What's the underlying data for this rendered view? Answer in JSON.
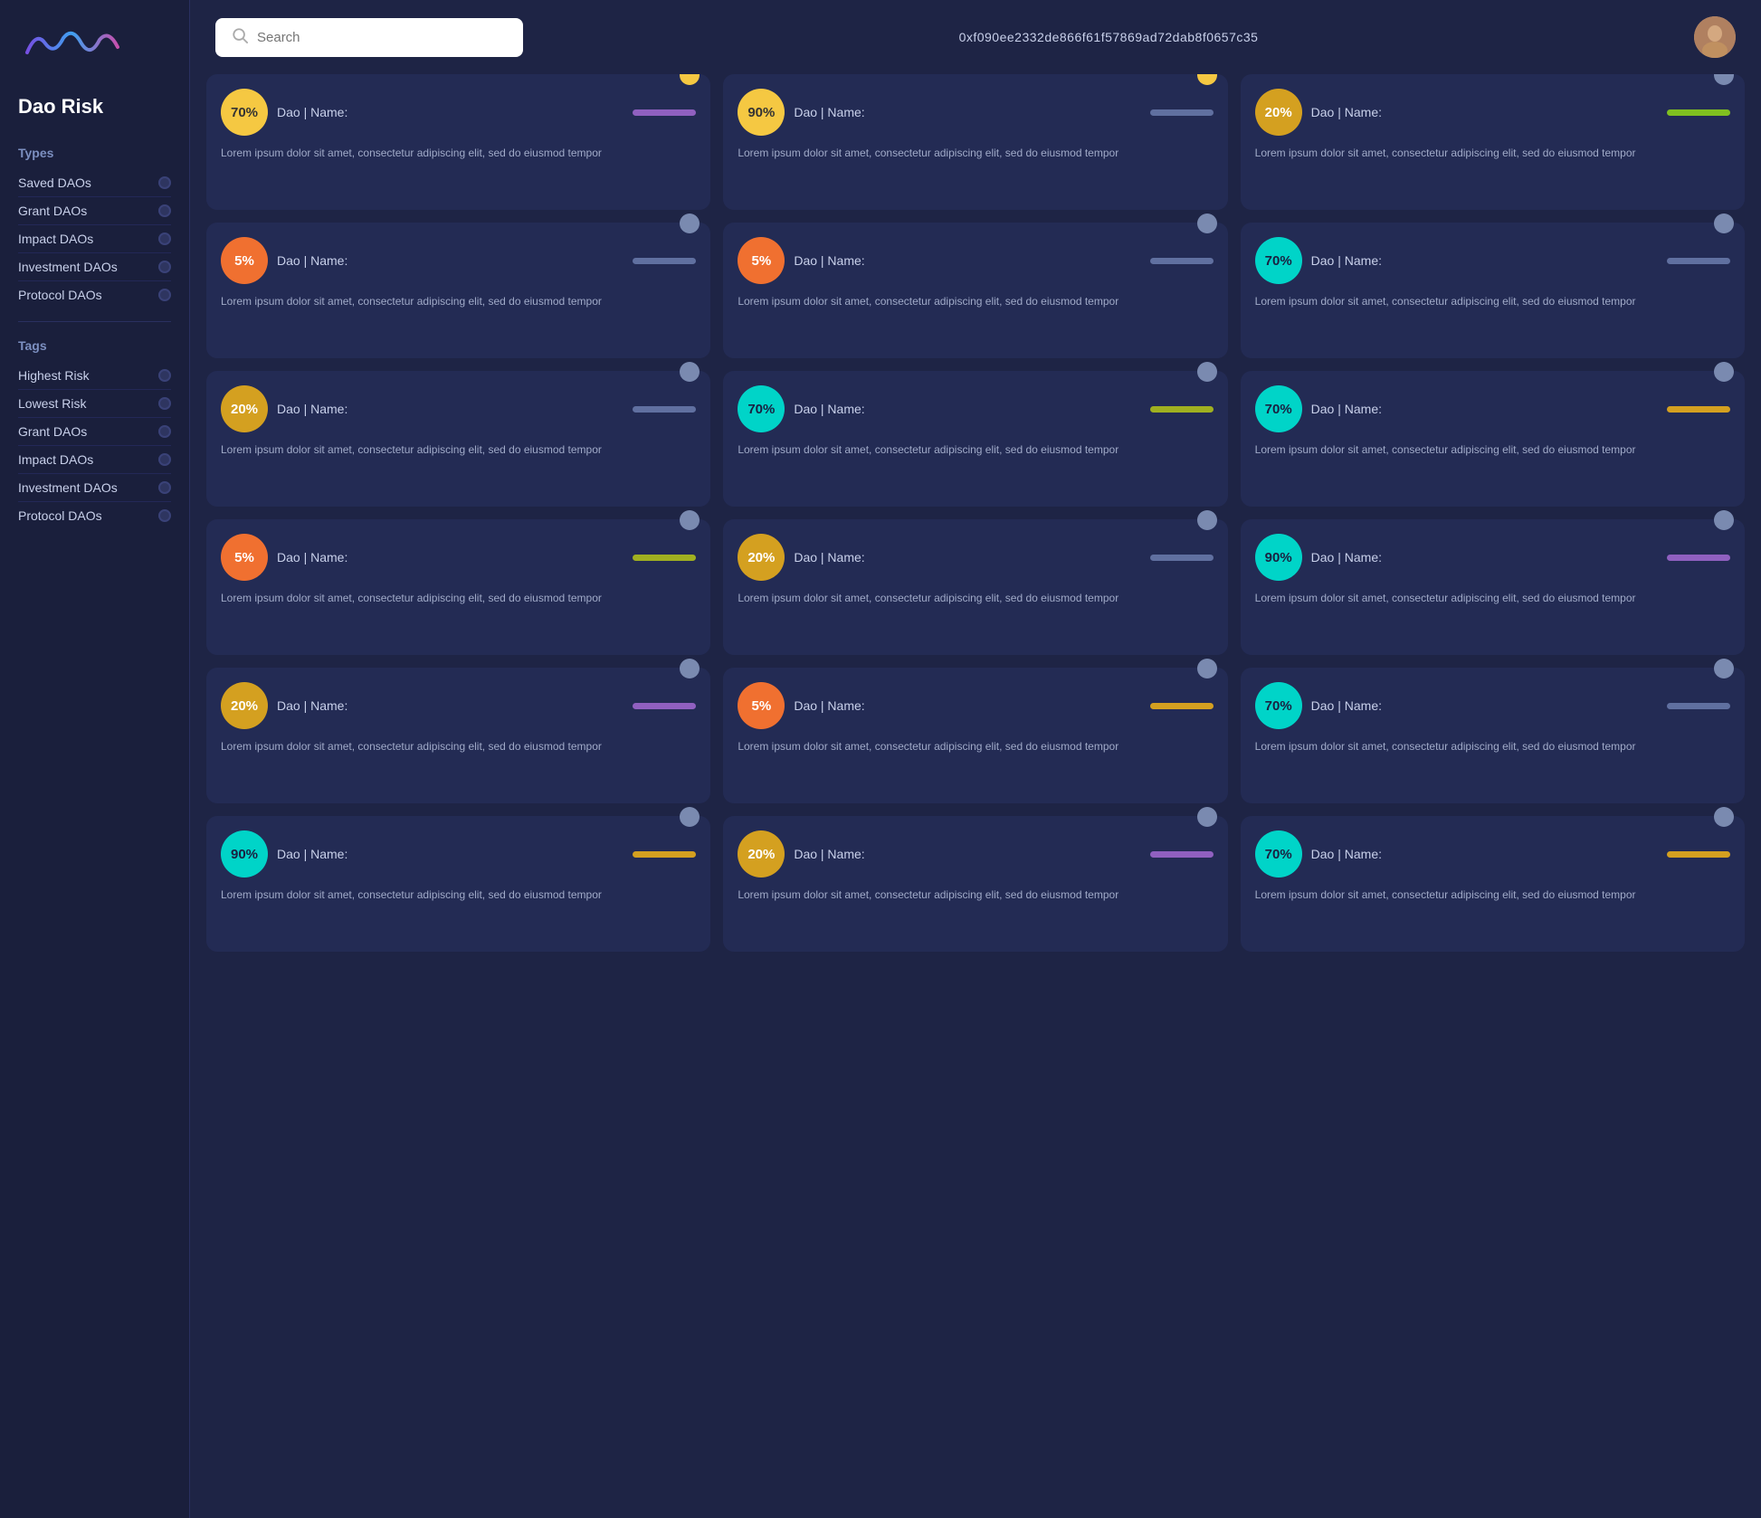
{
  "sidebar": {
    "title": "Dao Risk",
    "types_label": "Types",
    "tags_label": "Tags",
    "types": [
      {
        "label": "Saved DAOs"
      },
      {
        "label": "Grant DAOs"
      },
      {
        "label": "Impact DAOs"
      },
      {
        "label": "Investment DAOs"
      },
      {
        "label": "Protocol DAOs"
      }
    ],
    "tags": [
      {
        "label": "Highest Risk"
      },
      {
        "label": "Lowest Risk"
      },
      {
        "label": "Grant DAOs"
      },
      {
        "label": "Impact DAOs"
      },
      {
        "label": "Investment DAOs"
      },
      {
        "label": "Protocol DAOs"
      }
    ]
  },
  "header": {
    "search_placeholder": "Search",
    "wallet_address": "0xf090ee2332de866f61f57869ad72dab8f0657c35"
  },
  "cards": [
    {
      "risk": "70%",
      "badge_class": "badge-yellow",
      "dao_label": "Dao | Name:",
      "bar_class": "bar-purple",
      "dot_class": "dot-yellow",
      "body": "Lorem ipsum dolor sit amet, consectetur adipiscing elit, sed do eiusmod tempor"
    },
    {
      "risk": "90%",
      "badge_class": "badge-yellow",
      "dao_label": "Dao | Name:",
      "bar_class": "bar-gray",
      "dot_class": "dot-yellow",
      "body": "Lorem ipsum dolor sit amet, consectetur adipiscing elit, sed do eiusmod tempor"
    },
    {
      "risk": "20%",
      "badge_class": "badge-gold",
      "dao_label": "Dao | Name:",
      "bar_class": "bar-green",
      "dot_class": "dot-gray",
      "body": "Lorem ipsum dolor sit amet, consectetur adipiscing elit, sed do eiusmod tempor"
    },
    {
      "risk": "5%",
      "badge_class": "badge-orange",
      "dao_label": "Dao | Name:",
      "bar_class": "bar-gray",
      "dot_class": "dot-gray",
      "body": "Lorem ipsum dolor sit amet, consectetur adipiscing elit, sed do eiusmod tempor"
    },
    {
      "risk": "5%",
      "badge_class": "badge-orange",
      "dao_label": "Dao | Name:",
      "bar_class": "bar-gray",
      "dot_class": "dot-gray",
      "body": "Lorem ipsum dolor sit amet, consectetur adipiscing elit, sed do eiusmod tempor"
    },
    {
      "risk": "70%",
      "badge_class": "badge-teal",
      "dao_label": "Dao | Name:",
      "bar_class": "bar-gray",
      "dot_class": "dot-gray",
      "body": "Lorem ipsum dolor sit amet, consectetur adipiscing elit, sed do eiusmod tempor"
    },
    {
      "risk": "20%",
      "badge_class": "badge-gold",
      "dao_label": "Dao | Name:",
      "bar_class": "bar-gray",
      "dot_class": "dot-gray",
      "body": "Lorem ipsum dolor sit amet, consectetur adipiscing elit, sed do eiusmod tempor"
    },
    {
      "risk": "70%",
      "badge_class": "badge-teal",
      "dao_label": "Dao | Name:",
      "bar_class": "bar-olive",
      "dot_class": "dot-gray",
      "body": "Lorem ipsum dolor sit amet, consectetur adipiscing elit, sed do eiusmod tempor"
    },
    {
      "risk": "70%",
      "badge_class": "badge-teal",
      "dao_label": "Dao | Name:",
      "bar_class": "bar-amber",
      "dot_class": "dot-gray",
      "body": "Lorem ipsum dolor sit amet, consectetur adipiscing elit, sed do eiusmod tempor"
    },
    {
      "risk": "5%",
      "badge_class": "badge-orange",
      "dao_label": "Dao | Name:",
      "bar_class": "bar-olive",
      "dot_class": "dot-gray",
      "body": "Lorem ipsum dolor sit amet, consectetur adipiscing elit, sed do eiusmod tempor"
    },
    {
      "risk": "20%",
      "badge_class": "badge-gold",
      "dao_label": "Dao | Name:",
      "bar_class": "bar-gray",
      "dot_class": "dot-gray",
      "body": "Lorem ipsum dolor sit amet, consectetur adipiscing elit, sed do eiusmod tempor"
    },
    {
      "risk": "90%",
      "badge_class": "badge-teal",
      "dao_label": "Dao | Name:",
      "bar_class": "bar-purple",
      "dot_class": "dot-gray",
      "body": "Lorem ipsum dolor sit amet, consectetur adipiscing elit, sed do eiusmod tempor"
    },
    {
      "risk": "20%",
      "badge_class": "badge-gold",
      "dao_label": "Dao | Name:",
      "bar_class": "bar-purple",
      "dot_class": "dot-gray",
      "body": "Lorem ipsum dolor sit amet, consectetur adipiscing elit, sed do eiusmod tempor"
    },
    {
      "risk": "5%",
      "badge_class": "badge-orange",
      "dao_label": "Dao | Name:",
      "bar_class": "bar-amber",
      "dot_class": "dot-gray",
      "body": "Lorem ipsum dolor sit amet, consectetur adipiscing elit, sed do eiusmod tempor"
    },
    {
      "risk": "70%",
      "badge_class": "badge-teal",
      "dao_label": "Dao | Name:",
      "bar_class": "bar-gray",
      "dot_class": "dot-gray",
      "body": "Lorem ipsum dolor sit amet, consectetur adipiscing elit, sed do eiusmod tempor"
    },
    {
      "risk": "90%",
      "badge_class": "badge-teal",
      "dao_label": "Dao | Name:",
      "bar_class": "bar-amber",
      "dot_class": "dot-gray",
      "body": "Lorem ipsum dolor sit amet, consectetur adipiscing elit, sed do eiusmod tempor"
    },
    {
      "risk": "20%",
      "badge_class": "badge-gold",
      "dao_label": "Dao | Name:",
      "bar_class": "bar-purple",
      "dot_class": "dot-gray",
      "body": "Lorem ipsum dolor sit amet, consectetur adipiscing elit, sed do eiusmod tempor"
    },
    {
      "risk": "70%",
      "badge_class": "badge-teal",
      "dao_label": "Dao | Name:",
      "bar_class": "bar-amber",
      "dot_class": "dot-gray",
      "body": "Lorem ipsum dolor sit amet, consectetur adipiscing elit, sed do eiusmod tempor"
    }
  ]
}
